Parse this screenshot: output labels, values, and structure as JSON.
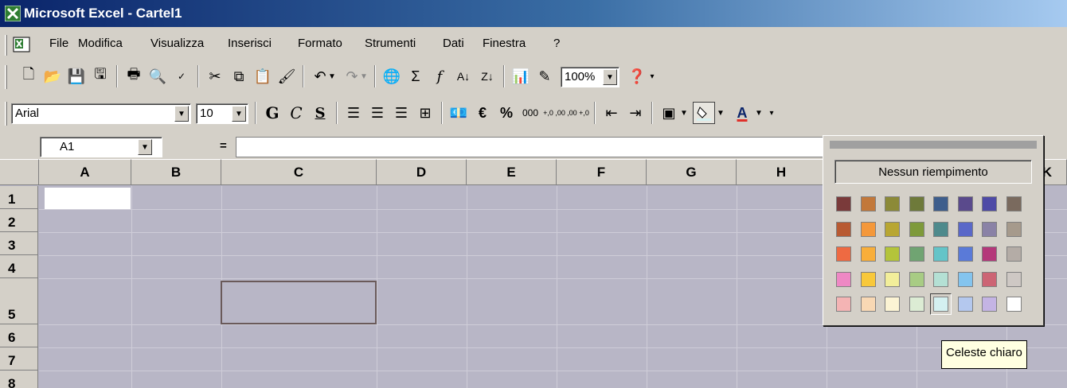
{
  "window": {
    "title": "Microsoft Excel - Cartel1"
  },
  "menu": {
    "items": [
      {
        "label": "File"
      },
      {
        "label": "Modifica"
      },
      {
        "label": "Visualizza"
      },
      {
        "label": "Inserisci"
      },
      {
        "label": "Formato"
      },
      {
        "label": "Strumenti"
      },
      {
        "label": "Dati"
      },
      {
        "label": "Finestra"
      },
      {
        "label": "?"
      }
    ]
  },
  "standard_toolbar": {
    "zoom": "100%",
    "icons": [
      "new-icon",
      "open-icon",
      "save-icon",
      "save-as-icon",
      "print-icon",
      "print-preview-icon",
      "spelling-icon",
      "cut-icon",
      "copy-icon",
      "paste-icon",
      "format-painter-icon",
      "undo-icon",
      "redo-icon",
      "hyperlink-icon",
      "autosum-icon",
      "function-icon",
      "sort-ascending-icon",
      "sort-descending-icon",
      "chart-wizard-icon",
      "drawing-icon",
      "help-icon"
    ]
  },
  "format_toolbar": {
    "font_name": "Arial",
    "font_size": "10",
    "bold": "G",
    "italic": "C",
    "underline": "S",
    "currency": "€",
    "percent": "%",
    "thousands": "000",
    "increase_decimal": "+,0 ,00",
    "decrease_decimal": ",00 +,0"
  },
  "formula_bar": {
    "name_box": "A1",
    "equals": "="
  },
  "sheet": {
    "columns": [
      "A",
      "B",
      "C",
      "D",
      "E",
      "F",
      "G",
      "H",
      "K"
    ],
    "rows": [
      "1",
      "2",
      "3",
      "4",
      "5",
      "6",
      "7",
      "8"
    ],
    "active_cell": "A1"
  },
  "color_popup": {
    "no_fill_label": "Nessun riempimento",
    "swatches": [
      [
        "#7a3a3a",
        "#c2783a",
        "#8c8a38",
        "#6e7a3a",
        "#3e5e8c",
        "#5a4a8c",
        "#4e4aa6",
        "#7a6a5e"
      ],
      [
        "#b85a32",
        "#f4983a",
        "#b8a632",
        "#7e9a3a",
        "#4e8a8c",
        "#5a68c8",
        "#8a82a6",
        "#a69a8c"
      ],
      [
        "#ee6a42",
        "#f8ae3a",
        "#b4c43a",
        "#70a472",
        "#64c4c8",
        "#5a7ad8",
        "#b4387a",
        "#b4aca6"
      ],
      [
        "#ee88c4",
        "#f8c83a",
        "#f2ee9a",
        "#a8cc84",
        "#b4e0d4",
        "#84c4ee",
        "#cc6474",
        "#cec8c4"
      ],
      [
        "#f4b4b4",
        "#f8d8b4",
        "#fcf4d4",
        "#dcecd4",
        "#d4f0f0",
        "#b4c8ee",
        "#c4b4e4",
        "#ffffff"
      ]
    ],
    "selected_name": "Celeste chiaro"
  }
}
